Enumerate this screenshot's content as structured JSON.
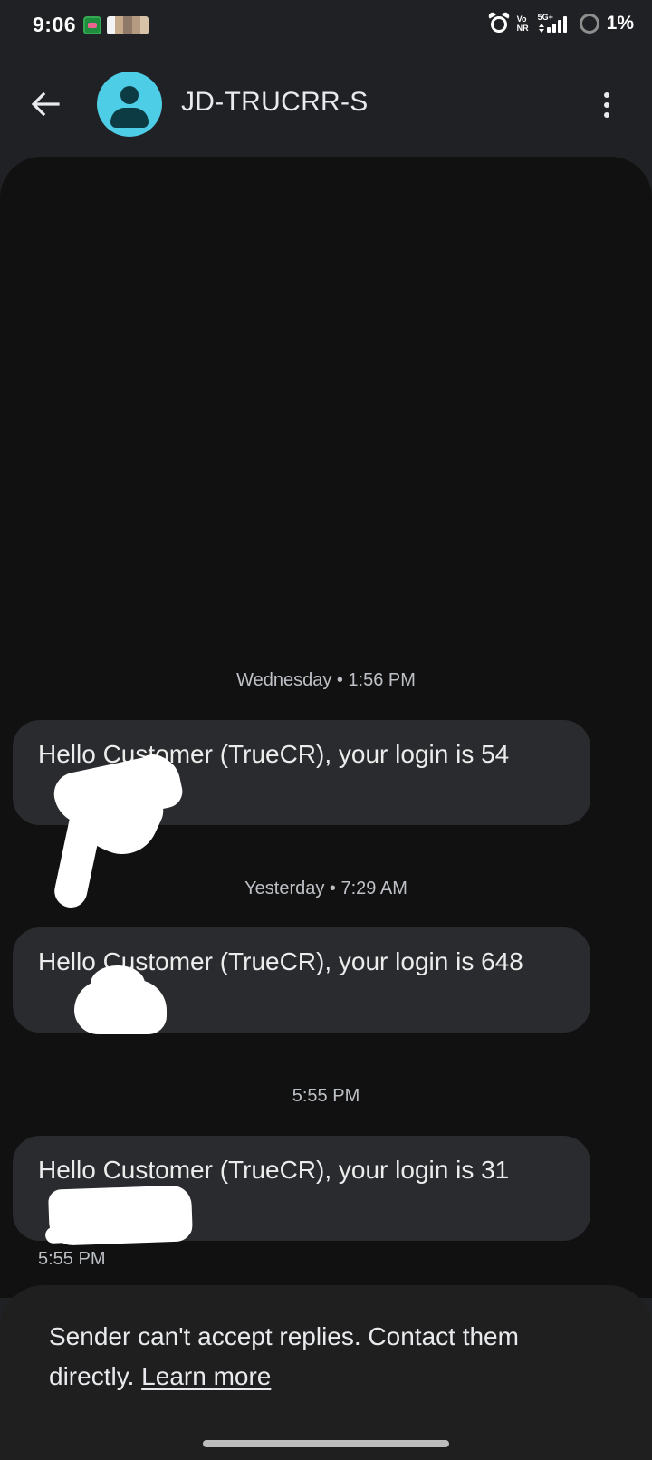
{
  "status_bar": {
    "time": "9:06",
    "network_top": "5G+",
    "volte_top": "Vo",
    "volte_bottom": "NR",
    "battery": "1%"
  },
  "header": {
    "contact_name": "JD-TRUCRR-S",
    "avatar_color": "#4ecde6"
  },
  "messages": [
    {
      "timestamp": "Wednesday • 1:56 PM",
      "text": "Hello Customer (TrueCR), your login is 54"
    },
    {
      "timestamp": "Yesterday • 7:29 AM",
      "text": "Hello Customer (TrueCR), your login is 648"
    },
    {
      "timestamp": "5:55 PM",
      "text": "Hello Customer (TrueCR), your login is 31",
      "sent_time": "5:55 PM"
    }
  ],
  "notice": {
    "text": "Sender can't accept replies. Contact them directly.",
    "link": "Learn more"
  }
}
